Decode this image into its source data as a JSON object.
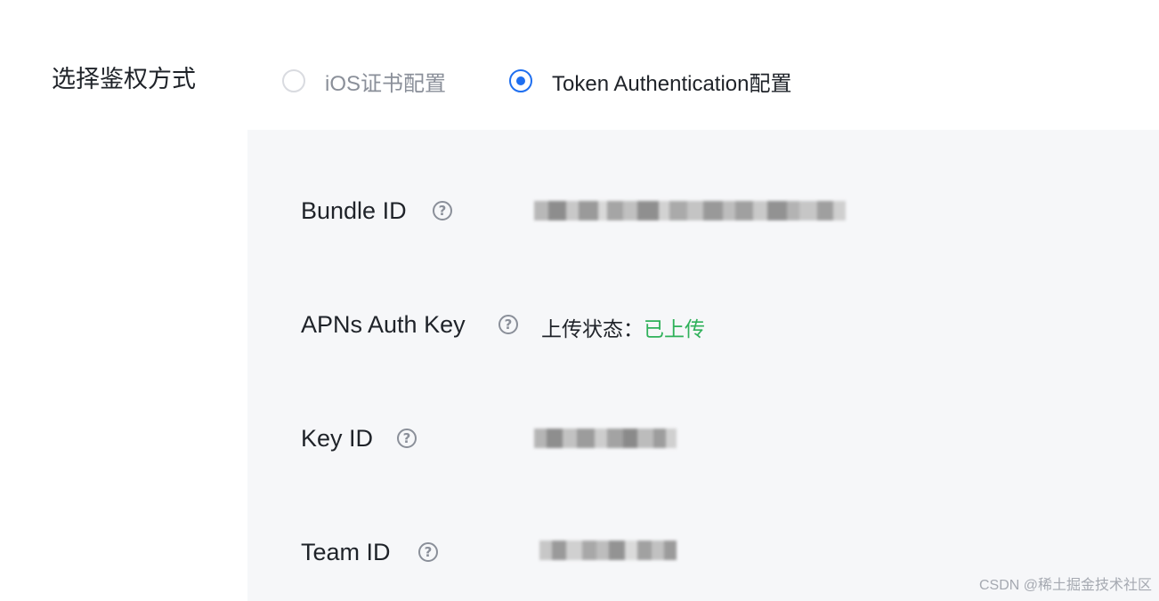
{
  "auth": {
    "label": "选择鉴权方式",
    "options": [
      {
        "label": "iOS证书配置",
        "selected": false
      },
      {
        "label": "Token Authentication配置",
        "selected": true
      }
    ]
  },
  "fields": {
    "bundle_id": {
      "label": "Bundle ID",
      "help_icon": "question-circle-icon",
      "value_redacted": true
    },
    "apns_auth_key": {
      "label": "APNs Auth Key",
      "help_icon": "question-circle-icon",
      "status_label": "上传状态：",
      "status_value": "已上传"
    },
    "key_id": {
      "label": "Key ID",
      "help_icon": "question-circle-icon",
      "value_redacted": true
    },
    "team_id": {
      "label": "Team ID",
      "help_icon": "question-circle-icon",
      "value_redacted": true
    }
  },
  "colors": {
    "accent": "#1f6ff0",
    "success": "#2fb15a",
    "panel_bg": "#f6f7f9",
    "text": "#1f2329",
    "muted": "#8a8f99"
  },
  "watermark": "CSDN @稀土掘金技术社区"
}
